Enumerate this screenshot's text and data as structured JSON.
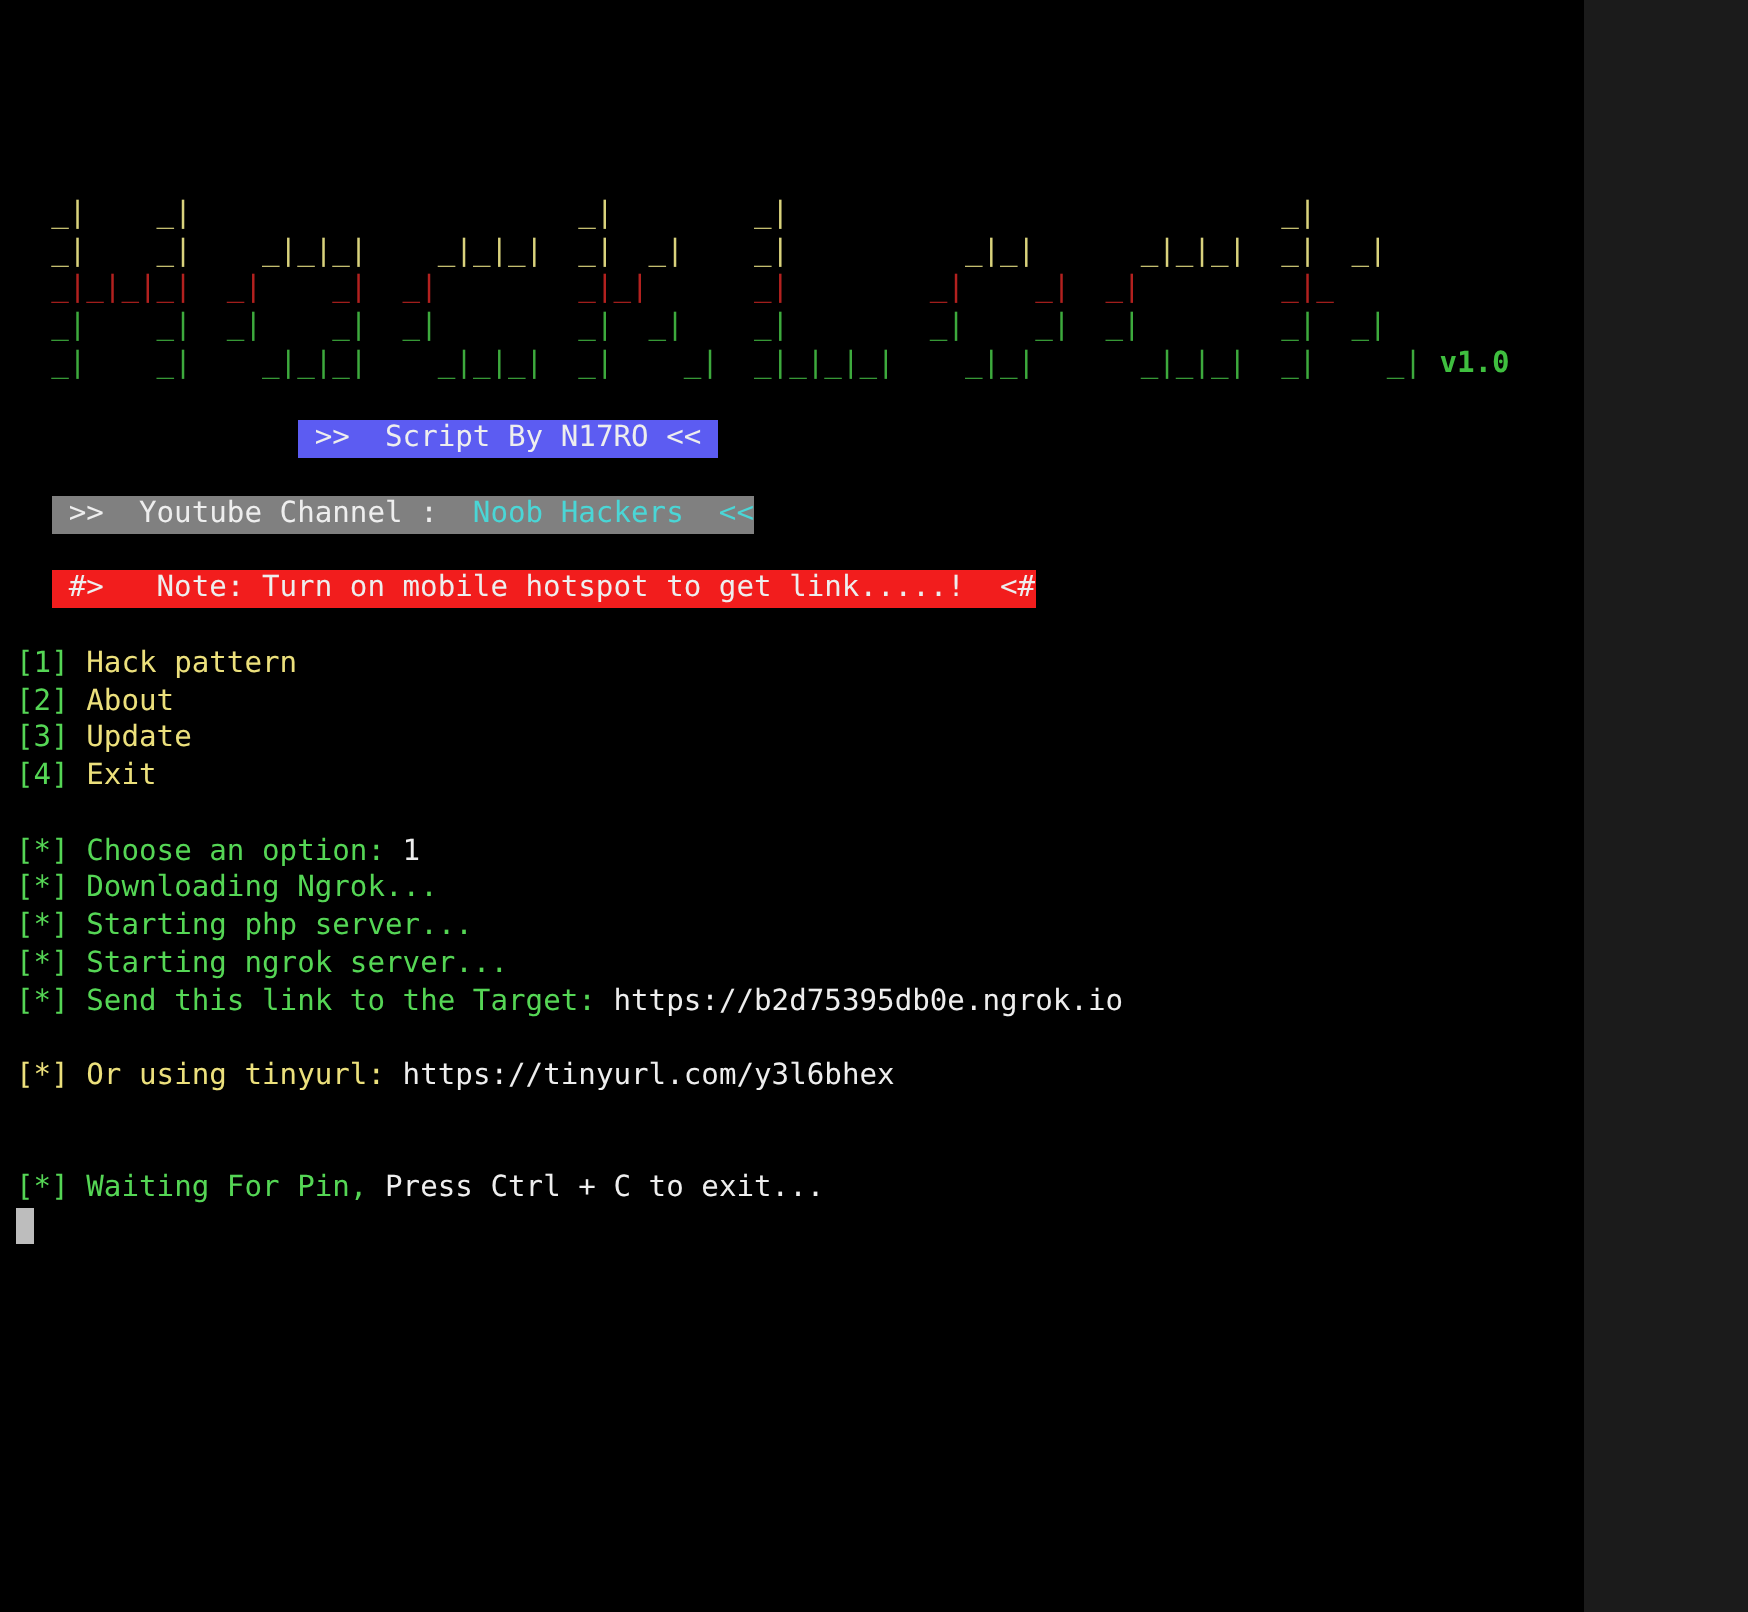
{
  "banner_art": {
    "lines": [
      {
        "text": "  _|    _|                      _|        _|                            _|",
        "color": "#d9d27c"
      },
      {
        "text": "  _|    _|    _|_|_|    _|_|_|  _|  _|    _|          _|_|      _|_|_|  _|  _|",
        "color": "#d9d27c"
      },
      {
        "text": "  _|_|_|_|  _|    _|  _|        _|_|      _|        _|    _|  _|        _|_",
        "color": "#b3211f"
      },
      {
        "text": "  _|    _|  _|    _|  _|        _|  _|    _|        _|    _|  _|        _|  _|",
        "color": "#3daa3d"
      },
      {
        "text": "  _|    _|    _|_|_|    _|_|_|  _|    _|  _|_|_|_|    _|_|      _|_|_|  _|    _|",
        "color": "#3daa3d"
      }
    ],
    "version": "v1.0"
  },
  "credit": {
    "text": ">>  Script By N17RO <<"
  },
  "channel": {
    "label": ">>  Youtube Channel :",
    "name": "Noob Hackers",
    "closer": "<<"
  },
  "note": {
    "opener": "#>",
    "text": "Note: Turn on mobile hotspot to get link.....!",
    "closer": "<#"
  },
  "menu": [
    {
      "number": "[1]",
      "label": "Hack pattern"
    },
    {
      "number": "[2]",
      "label": "About"
    },
    {
      "number": "[3]",
      "label": "Update"
    },
    {
      "number": "[4]",
      "label": "Exit"
    }
  ],
  "log": [
    {
      "kind": "blank"
    },
    {
      "kind": "status",
      "marker": "[*]",
      "message": "Choose an option:",
      "value": "1"
    },
    {
      "kind": "status",
      "marker": "[*]",
      "message": "Downloading Ngrok..."
    },
    {
      "kind": "status",
      "marker": "[*]",
      "message": "Starting php server..."
    },
    {
      "kind": "status",
      "marker": "[*]",
      "message": "Starting ngrok server..."
    },
    {
      "kind": "status",
      "marker": "[*]",
      "message": "Send this link to the Target:",
      "value": "https://b2d75395db0e.ngrok.io"
    },
    {
      "kind": "blank"
    },
    {
      "kind": "notice",
      "marker": "[*]",
      "message": "Or using tinyurl:",
      "value": "https://tinyurl.com/y3l6bhex"
    },
    {
      "kind": "blank"
    },
    {
      "kind": "blank"
    },
    {
      "kind": "status",
      "marker": "[*]",
      "message": "Waiting For Pin,",
      "value": "Press Ctrl + C to exit..."
    }
  ]
}
